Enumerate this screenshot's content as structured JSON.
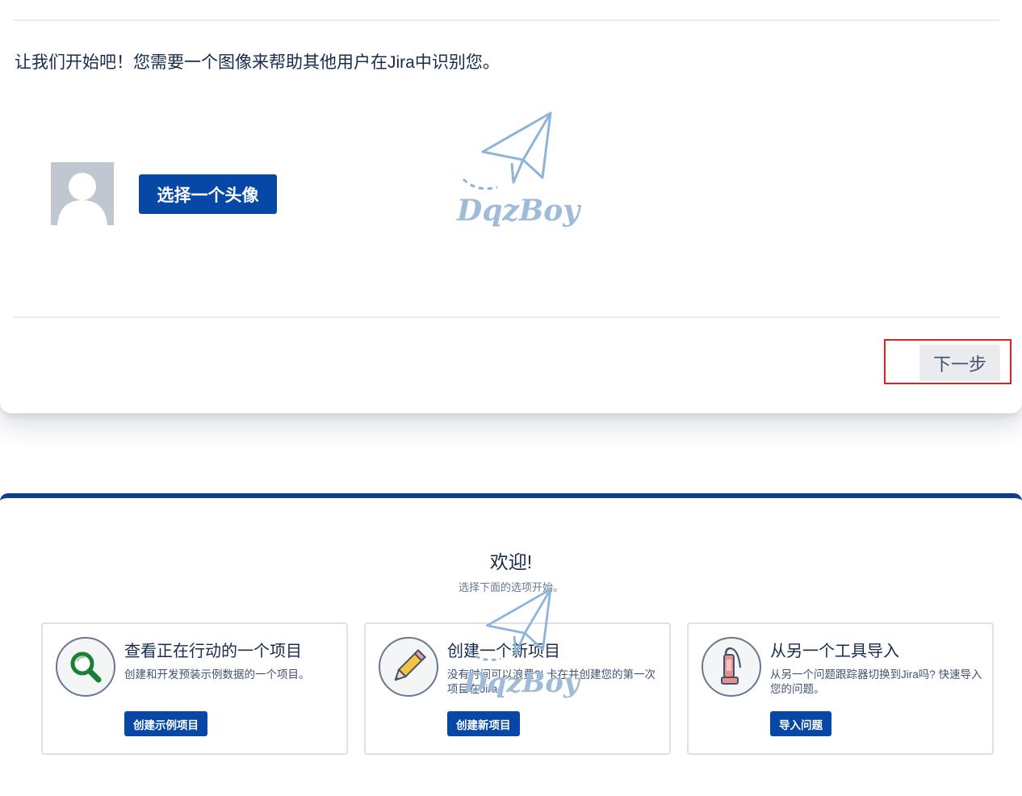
{
  "top": {
    "intro_text": "让我们开始吧！您需要一个图像来帮助其他用户在Jira中识别您。",
    "choose_avatar_label": "选择一个头像",
    "next_label": "下一步"
  },
  "welcome": {
    "title": "欢迎!",
    "subtitle": "选择下面的选项开始。"
  },
  "options": [
    {
      "icon": "magnifier-icon",
      "title": "查看正在行动的一个项目",
      "desc": "创建和开发预装示例数据的一个项目。",
      "button": "创建示例项目"
    },
    {
      "icon": "pencil-icon",
      "title": "创建一个新项目",
      "desc": "没有时间可以浪费?! 卡在并创建您的第一次项目在Jira。",
      "button": "创建新项目"
    },
    {
      "icon": "vacuum-icon",
      "title": "从另一个工具导入",
      "desc": "从另一个问题跟踪器切换到Jira吗? 快速导入您的问题。",
      "button": "导入问题"
    }
  ],
  "watermark": {
    "text": "DqzBoy"
  },
  "colors": {
    "primary": "#0747a6",
    "header_bar": "#0a3d91",
    "highlight": "#e02020",
    "next_bg": "#e9ebef"
  }
}
